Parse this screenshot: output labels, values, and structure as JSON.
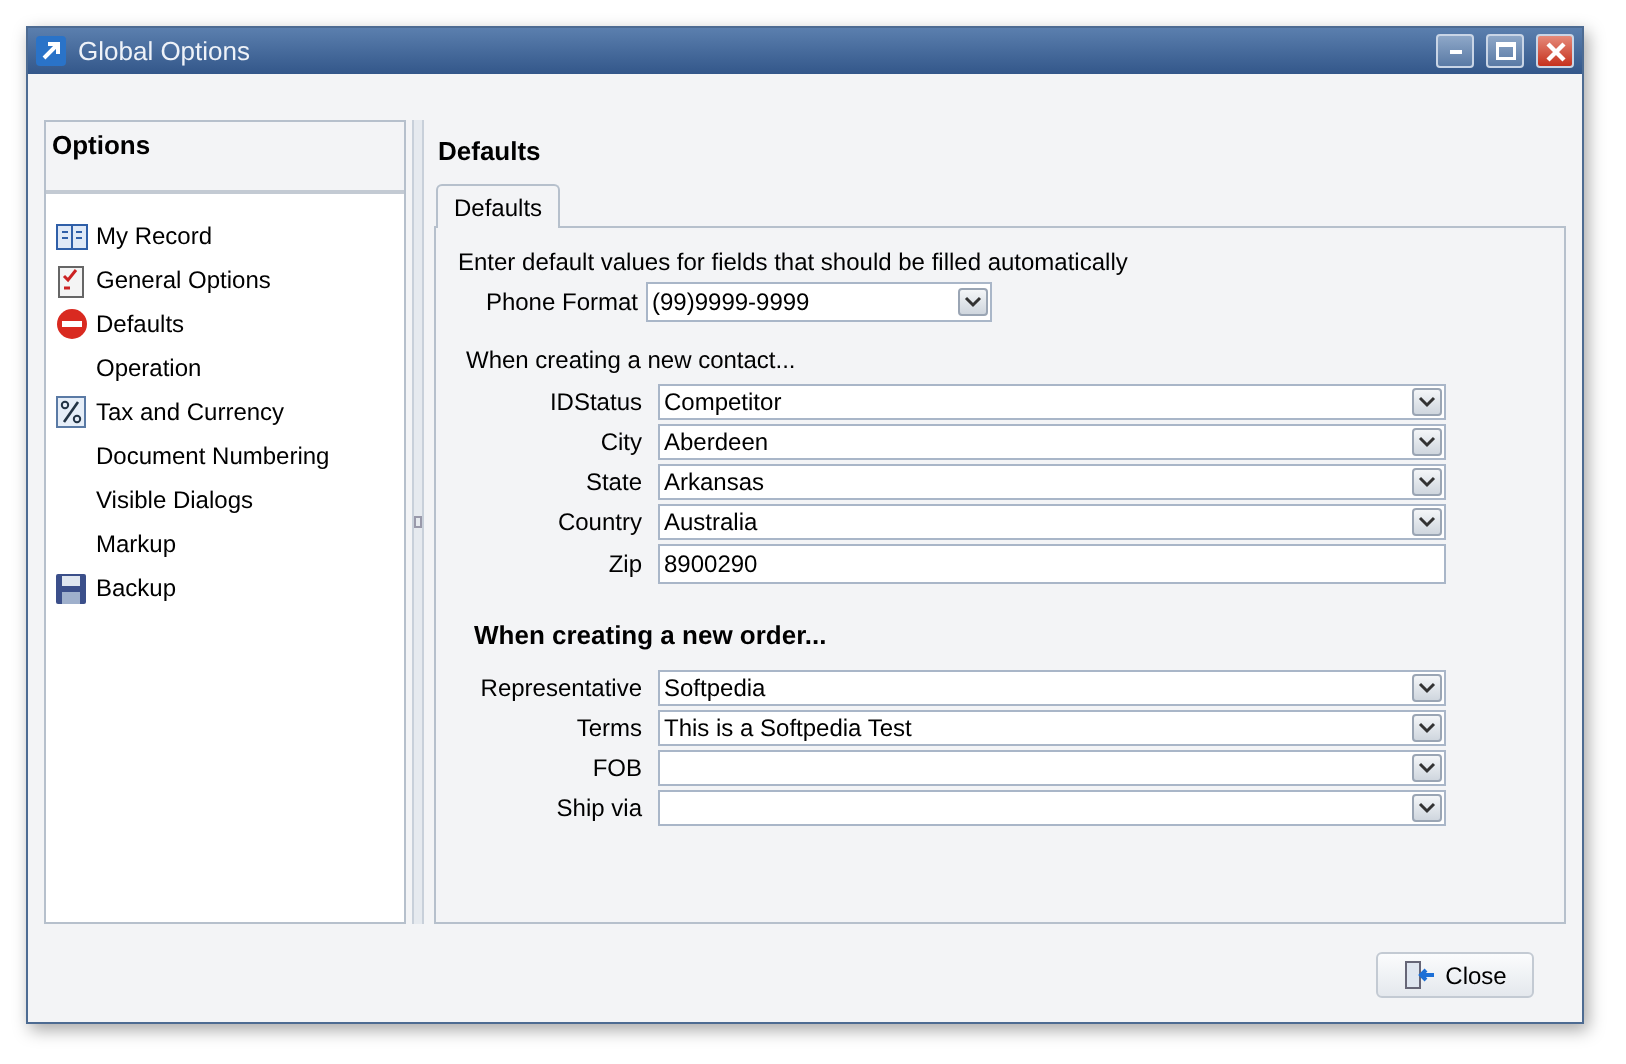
{
  "window": {
    "title": "Global Options"
  },
  "sidebar": {
    "title": "Options",
    "items": [
      {
        "label": "My Record",
        "kind": "book"
      },
      {
        "label": "General Options",
        "kind": "checklist"
      },
      {
        "label": "Defaults",
        "kind": "stop"
      },
      {
        "label": "Operation",
        "kind": "plain"
      },
      {
        "label": "Tax and Currency",
        "kind": "percent"
      },
      {
        "label": "Document Numbering",
        "kind": "plain"
      },
      {
        "label": "Visible Dialogs",
        "kind": "plain"
      },
      {
        "label": "Markup",
        "kind": "plain"
      },
      {
        "label": "Backup",
        "kind": "disk"
      }
    ]
  },
  "main": {
    "heading": "Defaults",
    "tabs": [
      {
        "label": "Defaults",
        "selected": true
      }
    ],
    "intro": "Enter default values for fields that should be filled automatically",
    "phone_format": {
      "label": "Phone Format",
      "value": "(99)9999-9999"
    },
    "contact_heading": "When creating a new contact...",
    "contact_fields": [
      {
        "label": "IDStatus",
        "value": "Competitor",
        "kind": "dropdown"
      },
      {
        "label": "City",
        "value": "Aberdeen",
        "kind": "dropdown"
      },
      {
        "label": "State",
        "value": "Arkansas",
        "kind": "dropdown"
      },
      {
        "label": "Country",
        "value": "Australia",
        "kind": "dropdown"
      },
      {
        "label": "Zip",
        "value": "8900290",
        "kind": "text"
      }
    ],
    "order_heading": "When creating a new order...",
    "order_fields": [
      {
        "label": "Representative",
        "value": "Softpedia",
        "kind": "dropdown"
      },
      {
        "label": "Terms",
        "value": "This is a Softpedia Test",
        "kind": "dropdown"
      },
      {
        "label": "FOB",
        "kind": "dropdown"
      },
      {
        "label": "Ship via",
        "kind": "dropdown"
      }
    ]
  },
  "close_button": "Close"
}
